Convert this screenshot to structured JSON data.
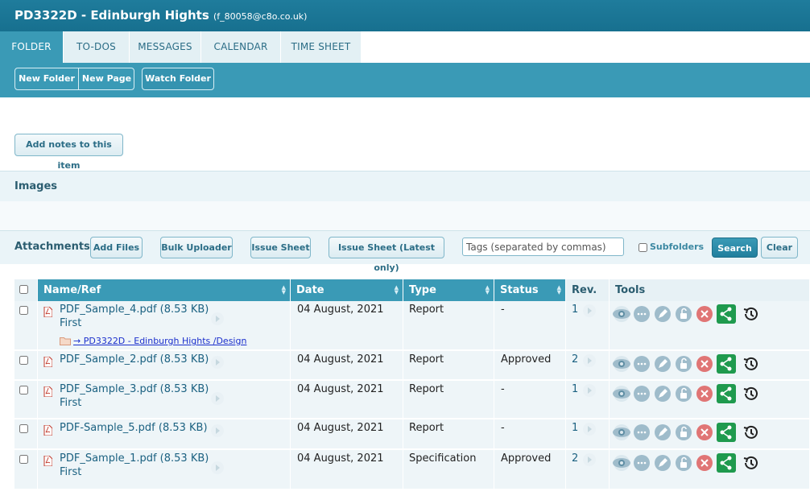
{
  "header": {
    "title": "PD3322D - Edinburgh Hights",
    "email": "(f_80058@c8o.co.uk)"
  },
  "tabs": [
    {
      "label": "FOLDER"
    },
    {
      "label": "TO-DOS"
    },
    {
      "label": "MESSAGES"
    },
    {
      "label": "CALENDAR"
    },
    {
      "label": "TIME SHEET"
    }
  ],
  "toolbar": {
    "new_folder": "New Folder",
    "new_page": "New Page",
    "watch_folder": "Watch Folder"
  },
  "notes": {
    "add_notes_label": "Add notes to this item"
  },
  "images": {
    "heading": "Images"
  },
  "attachments": {
    "heading": "Attachments",
    "add_files": "Add Files",
    "bulk_uploader": "Bulk Uploader",
    "issue_sheet": "Issue Sheet",
    "issue_sheet_latest": "Issue Sheet (Latest only)",
    "tags_placeholder": "Tags (separated by commas)",
    "subfolders_label": "Subfolders",
    "search": "Search",
    "clear": "Clear"
  },
  "table": {
    "headers": {
      "name": "Name/Ref",
      "date": "Date",
      "type": "Type",
      "status": "Status",
      "rev": "Rev.",
      "tools": "Tools"
    },
    "rows": [
      {
        "name": "PDF_Sample_4.pdf (8.53 KB)",
        "sub": "First",
        "link": "→ PD3322D - Edinburgh Hights /Design",
        "date": "04 August, 2021",
        "type": "Report",
        "status": "-",
        "rev": "1"
      },
      {
        "name": "PDF_Sample_2.pdf (8.53 KB)",
        "sub": "",
        "link": "",
        "date": "04 August, 2021",
        "type": "Report",
        "status": "Approved",
        "rev": "2"
      },
      {
        "name": "PDF_Sample_3.pdf (8.53 KB)",
        "sub": "First",
        "link": "",
        "date": "04 August, 2021",
        "type": "Report",
        "status": "-",
        "rev": "1"
      },
      {
        "name": "PDF-Sample_5.pdf (8.53 KB)",
        "sub": "",
        "link": "",
        "date": "04 August, 2021",
        "type": "Report",
        "status": "-",
        "rev": "1"
      },
      {
        "name": "PDF_Sample_1.pdf (8.53 KB)",
        "sub": "First",
        "link": "",
        "date": "04 August, 2021",
        "type": "Specification",
        "status": "Approved",
        "rev": "2"
      }
    ]
  },
  "icons": [
    "view-eye-icon",
    "comment-icon",
    "edit-pen-icon",
    "unlock-icon",
    "delete-icon",
    "share-icon",
    "history-icon"
  ],
  "colors": {
    "brand": "#1f7c9c",
    "accent": "#3a9ab6",
    "share": "#1f9a4e",
    "delete": "#e07575"
  }
}
